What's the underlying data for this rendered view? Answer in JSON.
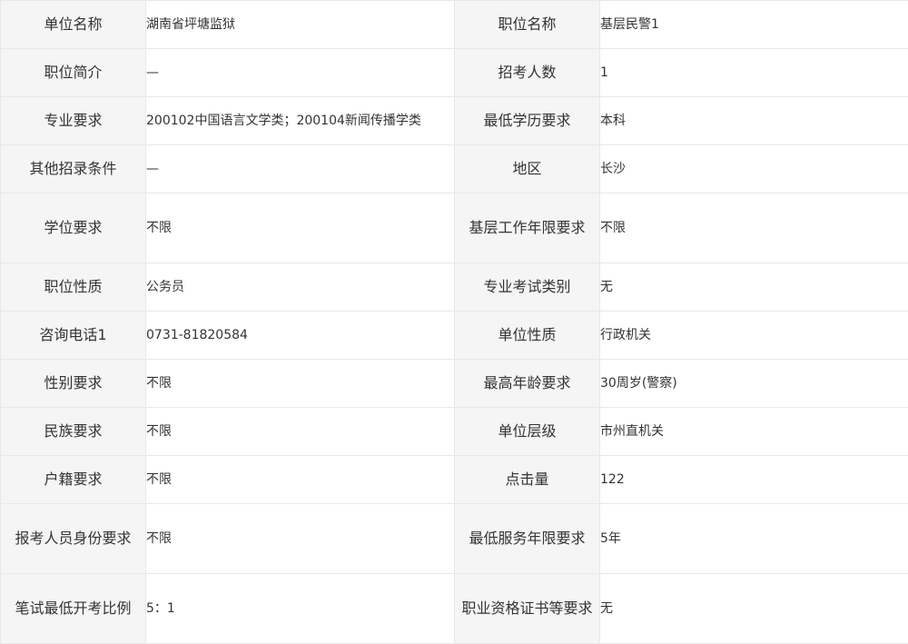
{
  "rows": [
    {
      "l1": "单位名称",
      "v1": "湖南省坪塘监狱",
      "l2": "职位名称",
      "v2": "基层民警1"
    },
    {
      "l1": "职位简介",
      "v1": "—",
      "l2": "招考人数",
      "v2": "1"
    },
    {
      "l1": "专业要求",
      "v1": "200102中国语言文学类；200104新闻传播学类",
      "l2": "最低学历要求",
      "v2": "本科"
    },
    {
      "l1": "其他招录条件",
      "v1": "—",
      "l2": "地区",
      "v2": "长沙"
    },
    {
      "l1": "学位要求",
      "v1": "不限",
      "l2": "基层工作年限要求",
      "v2": "不限"
    },
    {
      "l1": "职位性质",
      "v1": "公务员",
      "l2": "专业考试类别",
      "v2": "无"
    },
    {
      "l1": "咨询电话1",
      "v1": "0731-81820584",
      "l2": "单位性质",
      "v2": "行政机关"
    },
    {
      "l1": "性别要求",
      "v1": "不限",
      "l2": "最高年龄要求",
      "v2": "30周岁(警察)"
    },
    {
      "l1": "民族要求",
      "v1": "不限",
      "l2": "单位层级",
      "v2": "市州直机关"
    },
    {
      "l1": "户籍要求",
      "v1": "不限",
      "l2": "点击量",
      "v2": "122"
    },
    {
      "l1": "报考人员身份要求",
      "v1": "不限",
      "l2": "最低服务年限要求",
      "v2": "5年"
    },
    {
      "l1": "笔试最低开考比例",
      "v1": "5：1",
      "l2": "职业资格证书等要求",
      "v2": "无"
    }
  ]
}
